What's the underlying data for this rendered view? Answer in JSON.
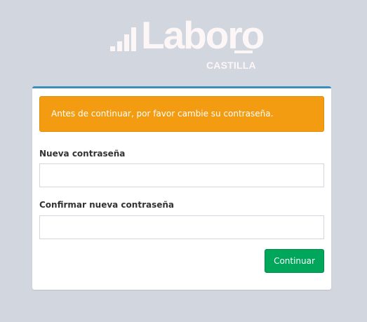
{
  "logo": {
    "wordmark": "Laboro",
    "subtitle": "CASTILLA"
  },
  "alert": {
    "message": "Antes de continuar, por favor cambie su contraseña.",
    "color": "#f39c12"
  },
  "form": {
    "new_password_label": "Nueva contraseña",
    "new_password_value": "",
    "confirm_password_label": "Confirmar nueva contraseña",
    "confirm_password_value": "",
    "submit_label": "Continuar"
  },
  "colors": {
    "background": "#d2d6de",
    "card_accent": "#3c8dbc",
    "button": "#00a65a"
  }
}
